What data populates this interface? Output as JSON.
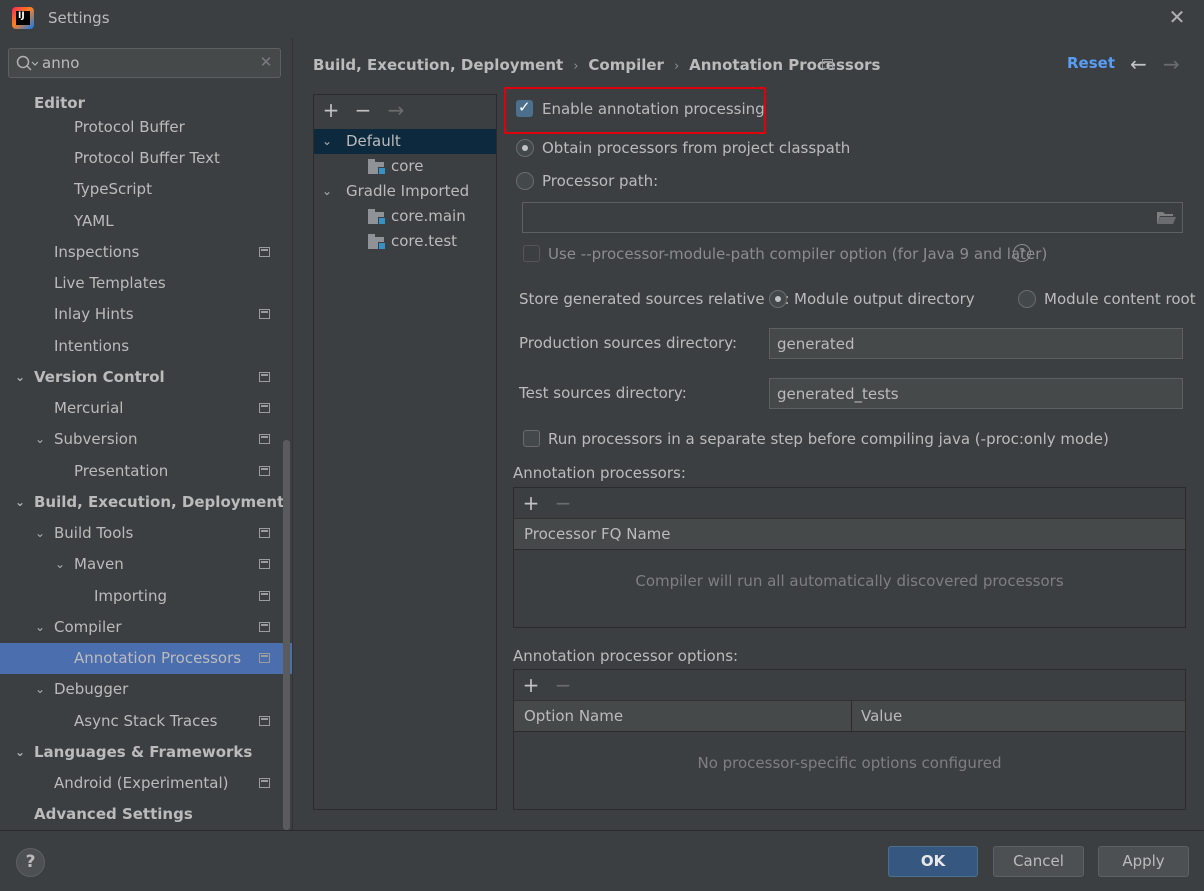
{
  "window": {
    "title": "Settings",
    "logo_text": "IJ"
  },
  "search": {
    "value": "anno"
  },
  "tree": {
    "editor": "Editor",
    "protocol_buffer": "Protocol Buffer",
    "protocol_buffer_text": "Protocol Buffer Text",
    "typescript": "TypeScript",
    "yaml": "YAML",
    "inspections": "Inspections",
    "live_templates": "Live Templates",
    "inlay_hints": "Inlay Hints",
    "intentions": "Intentions",
    "version_control": "Version Control",
    "mercurial": "Mercurial",
    "subversion": "Subversion",
    "presentation": "Presentation",
    "build_execution_deployment": "Build, Execution, Deployment",
    "build_tools": "Build Tools",
    "maven": "Maven",
    "importing": "Importing",
    "compiler": "Compiler",
    "annotation_processors": "Annotation Processors",
    "debugger": "Debugger",
    "async_stack_traces": "Async Stack Traces",
    "languages_frameworks": "Languages & Frameworks",
    "android_experimental": "Android (Experimental)",
    "advanced_settings": "Advanced Settings"
  },
  "breadcrumb": {
    "part1": "Build, Execution, Deployment",
    "part2": "Compiler",
    "part3": "Annotation Processors",
    "separator": "›"
  },
  "header": {
    "reset": "Reset"
  },
  "profiles": {
    "default": "Default",
    "default_core": "core",
    "gradle_imported": "Gradle Imported",
    "core_main": "core.main",
    "core_test": "core.test"
  },
  "options": {
    "enable_annotation_processing": "Enable annotation processing",
    "obtain_from_classpath": "Obtain processors from project classpath",
    "processor_path": "Processor path:",
    "use_module_path": "Use --processor-module-path compiler option (for Java 9 and later)",
    "store_generated_label": "Store generated sources relative to:",
    "module_output_directory": "Module output directory",
    "module_content_root": "Module content root",
    "production_sources_label": "Production sources directory:",
    "production_sources_value": "generated",
    "test_sources_label": "Test sources directory:",
    "test_sources_value": "generated_tests",
    "run_separate_step": "Run processors in a separate step before compiling java (-proc:only mode)"
  },
  "annotation_processors": {
    "title": "Annotation processors:",
    "column": "Processor FQ Name",
    "empty": "Compiler will run all automatically discovered processors"
  },
  "processor_options": {
    "title": "Annotation processor options:",
    "column_name": "Option Name",
    "column_value": "Value",
    "empty": "No processor-specific options configured"
  },
  "footer": {
    "help": "?",
    "ok": "OK",
    "cancel": "Cancel",
    "apply": "Apply"
  },
  "glyphs": {
    "add": "+",
    "remove": "−",
    "move": "→",
    "back": "←",
    "forward": "→",
    "close": "✕",
    "expanded": "⌄",
    "help": "?"
  },
  "colors": {
    "accent": "#4b6eaf",
    "link": "#589df6",
    "highlight": "#e0000b",
    "primary_button": "#365880"
  }
}
